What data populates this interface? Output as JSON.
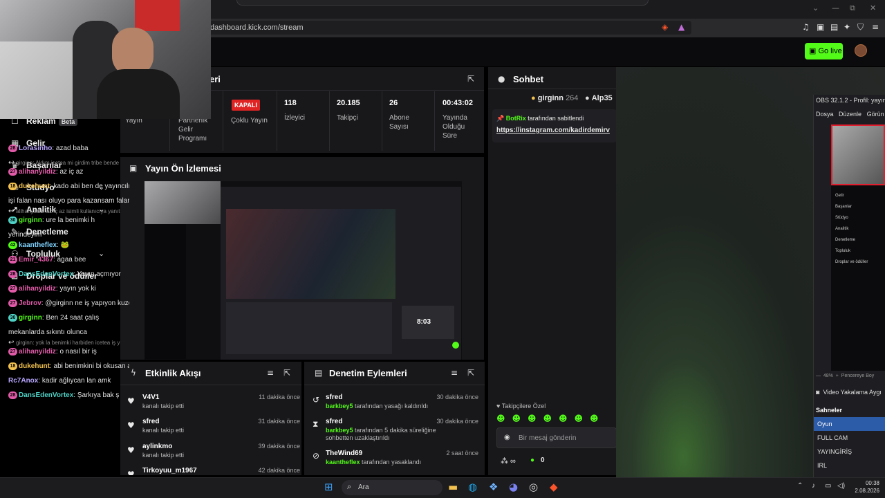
{
  "browser": {
    "url": "dashboard.kick.com/stream",
    "window_controls": [
      "⌄",
      "—",
      "⧉",
      "✕"
    ],
    "toolbar_icons": [
      "music-icon",
      "sidebar-icon",
      "tab-icon",
      "sparkle-icon",
      "shield-icon",
      "menu-icon"
    ]
  },
  "header": {
    "go_live_label": "Go live"
  },
  "sidebar": {
    "items": [
      {
        "label": "Reklam",
        "badge": "Beta",
        "icon": "ad-icon"
      },
      {
        "label": "Gelir",
        "icon": "money-icon"
      },
      {
        "label": "Başarılar",
        "icon": "trophy-icon"
      },
      {
        "label": "Stüdyo",
        "icon": "studio-icon",
        "expandable": true
      },
      {
        "label": "Analitik",
        "icon": "chart-icon",
        "expandable": true
      },
      {
        "label": "Denetleme",
        "icon": "wrench-icon"
      },
      {
        "label": "Topluluk",
        "icon": "people-icon",
        "expandable": true
      },
      {
        "label": "Droplar ve ödüller",
        "icon": "gift-icon"
      }
    ]
  },
  "stream_info": {
    "title_fragment": "eri",
    "stats": [
      {
        "value": "",
        "label": "Yayın"
      },
      {
        "value": "",
        "label": "Partnerlik Gelir Programı"
      },
      {
        "value": "KAPALI",
        "label": "Çoklu Yayın"
      },
      {
        "value": "118",
        "label": "İzleyici"
      },
      {
        "value": "20.185",
        "label": "Takipçi"
      },
      {
        "value": "26",
        "label": "Abone Sayısı"
      },
      {
        "value": "00:43:02",
        "label": "Yayında Olduğu Süre"
      }
    ]
  },
  "preview": {
    "title": "Yayın Ön İzlemesi",
    "timer": "8:03"
  },
  "activity": {
    "title": "Etkinlik Akışı",
    "items": [
      {
        "name": "V4V1",
        "sub": "kanalı takip etti",
        "time": "11 dakika önce"
      },
      {
        "name": "sfred",
        "sub": "kanalı takip etti",
        "time": "31 dakika önce"
      },
      {
        "name": "aylinkmo",
        "sub": "kanalı takip etti",
        "time": "39 dakika önce"
      },
      {
        "name": "Tirkoyuu_m1967",
        "sub": "",
        "time": "42 dakika önce"
      }
    ]
  },
  "moderation": {
    "title": "Denetim Eylemleri",
    "items": [
      {
        "name": "sfred",
        "actor": "barkbey5",
        "sub": " tarafından yasağı kaldırıldı",
        "time": "30 dakika önce",
        "icon": "undo-icon"
      },
      {
        "name": "sfred",
        "actor": "barkbey5",
        "sub": " tarafından 5 dakika süreliğine sohbetten uzaklaştırıldı",
        "time": "30 dakika önce",
        "icon": "hourglass-icon"
      },
      {
        "name": "TheWind69",
        "actor": "kaantheflex",
        "sub": " tarafından yasaklandı",
        "time": "2 saat önce",
        "icon": "ban-icon"
      }
    ]
  },
  "chat": {
    "title": "Sohbet",
    "top_gifters": [
      {
        "name": "girginn",
        "count": "264"
      },
      {
        "name": "Alp35",
        "count": ""
      }
    ],
    "pinned": {
      "by": "BotRix",
      "text": " tarafından sabitlendi",
      "link": "https://instagram.com/kadirdemirv"
    },
    "messages": [
      {
        "badge": "28",
        "user": "Lorasinho",
        "color": "#b9a6ff",
        "text": ": azad baba"
      },
      {
        "sys": "girginn: Aldım icetea mi girdim tribe bende"
      },
      {
        "badge": "27",
        "user": "alihanyildiz",
        "color": "#e05aa8",
        "text": ": az iç az"
      },
      {
        "badge": "18",
        "user": "dukehunt",
        "color": "#f2c14e",
        "text": ": kado abi ben de yayıncılı"
      },
      {
        "text2": "işi falan nası oluyo para kazansam falan"
      },
      {
        "sys": "alihanyildiz: az iç az isimli kullanıcıya yanıt"
      },
      {
        "badge": "30",
        "user": "girginn",
        "color": "#53fc18",
        "text": ": ure la benimki h"
      },
      {
        "text2": "yerindeyim"
      },
      {
        "badge": "42",
        "user": "kaantheflex",
        "color": "#7fd3ff",
        "text": ": 🐸"
      },
      {
        "badge": "21",
        "user": "Emir_4367",
        "color": "#e05aa8",
        "text": ": agaa bee"
      },
      {
        "badge": "28",
        "user": "DansEdenVortex",
        "color": "#4fd1c5",
        "text": ": Yayın açmıyor"
      },
      {
        "badge": "27",
        "user": "alihanyildiz",
        "color": "#e05aa8",
        "text": ": yayın yok ki"
      },
      {
        "badge": "27",
        "user": "Jebrov",
        "color": "#e05aa8",
        "text": ": @girginn ne iş yapıyon kuzen"
      },
      {
        "badge": "30",
        "user": "girginn",
        "color": "#53fc18",
        "text": ": Ben 24 saat çalış"
      },
      {
        "text2": "mekanlarda sıkıntı olunca"
      },
      {
        "sys": "girginn: yok la benimki harbiden icetea iş y"
      },
      {
        "badge": "27",
        "user": "alihanyildiz",
        "color": "#e05aa8",
        "text": ": o nasıl bir iş"
      },
      {
        "badge": "18",
        "user": "dukehunt",
        "color": "#f2c14e",
        "text": ": abi benimkini bi okusan a"
      },
      {
        "user": "Rc7Anox",
        "color": "#b9a6ff",
        "text": ": kadir ağlıycan lan amk"
      },
      {
        "badge": "28",
        "user": "DansEdenVortex",
        "color": "#4fd1c5",
        "text": ": Şarkıya bak ş"
      }
    ],
    "followers_only": "Takipçilere Özel",
    "input_placeholder": "Bir mesaj gönderin",
    "footer_count": "0"
  },
  "obs": {
    "title": "OBS 32.1.2 - Profil: yayın",
    "menu": [
      "Dosya",
      "Düzenle",
      "Görün"
    ],
    "dock_items": [
      "Gelir",
      "Başarılar",
      "Stüdyo",
      "Analitik",
      "Denetleme",
      "Topluluk",
      "Droplar ve ödüller"
    ],
    "zoom": "48%",
    "zoom_label": "Pencereye Boy",
    "source": "Video Yakalama Aygı",
    "scenes_title": "Sahneler",
    "scenes": [
      "Oyun",
      "FULL CAM",
      "YAYINGİRİŞ",
      "IRL"
    ]
  },
  "taskbar": {
    "search": "Ara",
    "time": "00:38",
    "date": "2.08.2026"
  }
}
